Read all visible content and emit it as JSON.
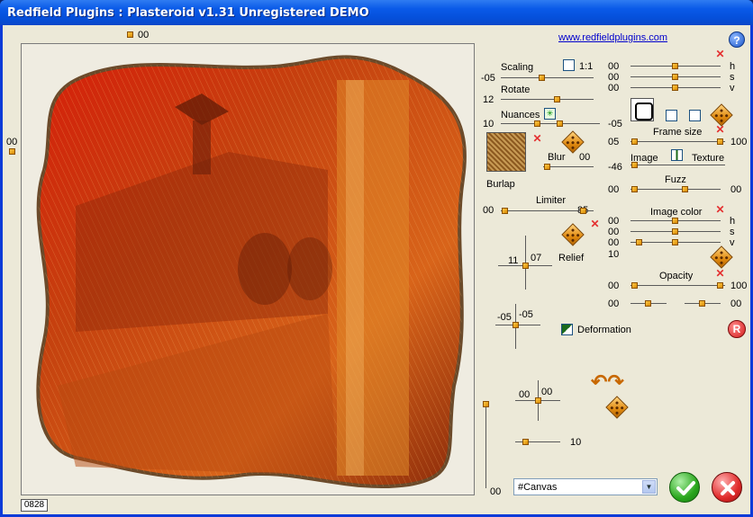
{
  "window": {
    "title": "Redfield Plugins : Plasteroid v1.31   Unregistered  DEMO"
  },
  "header": {
    "top_value": "00",
    "link": "www.redfieldplugins.com",
    "help_label": "?"
  },
  "preview": {
    "left_value": "00",
    "status_value": "0828",
    "right_value": "00"
  },
  "left_panel": {
    "scaling": {
      "label": "Scaling",
      "value": "-05",
      "ratio_label": "1:1"
    },
    "rotate": {
      "label": "Rotate",
      "value": "12"
    },
    "nuances": {
      "label": "Nuances",
      "value": "10",
      "value_right": "-05"
    },
    "texture": {
      "name": "Burlap"
    },
    "blur": {
      "label": "Blur",
      "value": "00",
      "value_left": "-46"
    },
    "limiter": {
      "label": "Limiter",
      "value_left": "00",
      "value_right": "85"
    },
    "relief": {
      "label": "Relief",
      "value_x": "11",
      "value_y": "07"
    },
    "deformation": {
      "label": "Deformation",
      "value_x": "-05",
      "value_y": "-05"
    },
    "offset": {
      "value_x": "00",
      "value_y": "00"
    },
    "amount": {
      "value": "10"
    }
  },
  "right_panel": {
    "hsv1": {
      "h": "00",
      "s": "00",
      "v": "00",
      "h_label": "h",
      "s_label": "s",
      "v_label": "v"
    },
    "frame_size": {
      "label": "Frame size",
      "value_left": "05",
      "value_right": "100"
    },
    "image_texture": {
      "image_label": "Image",
      "texture_label": "Texture"
    },
    "fuzz": {
      "label": "Fuzz",
      "value_left": "00",
      "value_right": "00"
    },
    "image_color": {
      "label": "Image color",
      "h": "00",
      "s": "00",
      "v": "00",
      "extra": "10",
      "h_label": "h",
      "s_label": "s",
      "v_label": "v"
    },
    "opacity": {
      "label": "Opacity",
      "value_left": "00",
      "value_right": "100",
      "bottom_left": "00",
      "bottom_right": "00"
    },
    "reset_label": "R"
  },
  "footer": {
    "layer_select": "#Canvas"
  },
  "colors": {
    "accent": "#0c3bd8",
    "knob": "#e08a10",
    "close_red": "#e43030"
  }
}
